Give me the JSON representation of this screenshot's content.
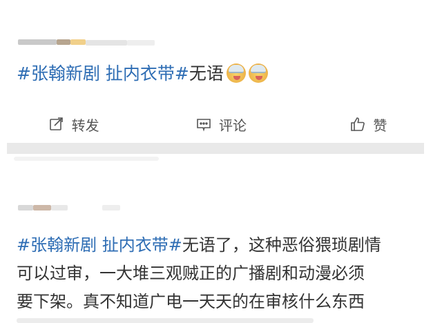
{
  "post1": {
    "hashtag": "#张翰新剧 扯内衣带#",
    "text": "无语",
    "emojis": [
      "sick-face-emoji",
      "sick-face-emoji"
    ]
  },
  "actions": {
    "repost_label": "转发",
    "comment_label": "评论",
    "like_label": "赞"
  },
  "post2": {
    "hashtag": "#张翰新剧 扯内衣带#",
    "line1": "无语了，这种恶俗猥琐剧情",
    "line2": "可以过审，一大堆三观贼正的广播剧和动漫必须",
    "line3": "要下架。真不知道广电一天天的在审核什么东西"
  },
  "colors": {
    "hashtag": "#2e6db4",
    "text": "#333333",
    "action_text": "#555555",
    "divider": "#e9e9e9"
  }
}
